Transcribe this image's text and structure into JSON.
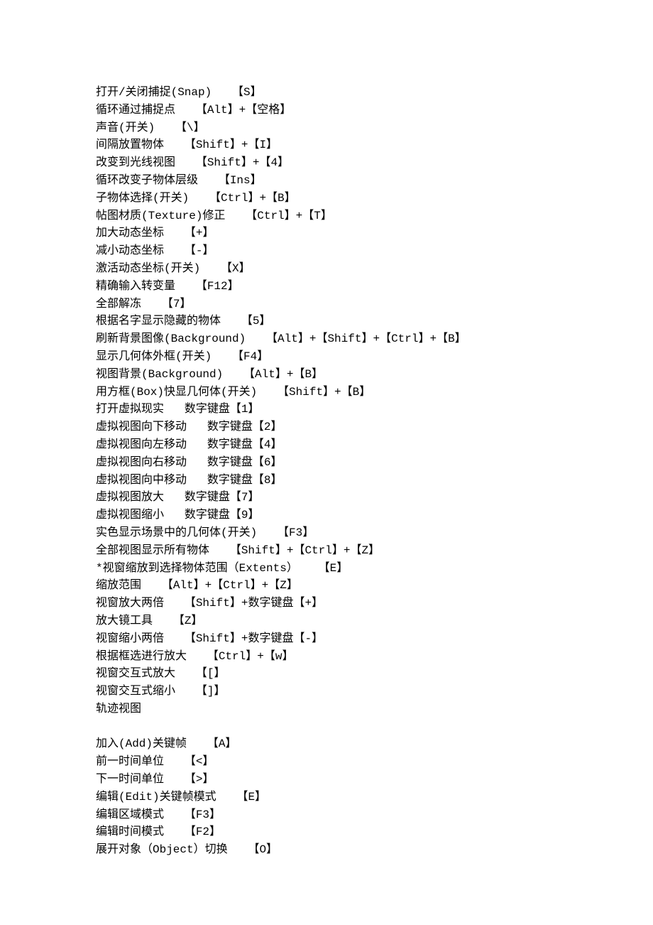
{
  "group1": [
    {
      "label": "打开/关闭捕捉(Snap)",
      "key": "【S】"
    },
    {
      "label": "循环通过捕捉点",
      "key": "【Alt】+【空格】"
    },
    {
      "label": "声音(开关)",
      "key": "【\\】"
    },
    {
      "label": "间隔放置物体",
      "key": "【Shift】+【I】"
    },
    {
      "label": "改变到光线视图",
      "key": "【Shift】+【4】"
    },
    {
      "label": "循环改变子物体层级",
      "key": "【Ins】"
    },
    {
      "label": "子物体选择(开关)",
      "key": "【Ctrl】+【B】"
    },
    {
      "label": "帖图材质(Texture)修正",
      "key": "【Ctrl】+【T】"
    },
    {
      "label": "加大动态坐标",
      "key": "【+】"
    },
    {
      "label": "减小动态坐标",
      "key": "【-】"
    },
    {
      "label": "激活动态坐标(开关)",
      "key": "【X】"
    },
    {
      "label": "精确输入转变量",
      "key": "【F12】"
    },
    {
      "label": "全部解冻",
      "key": "【7】"
    },
    {
      "label": "根据名字显示隐藏的物体",
      "key": "【5】"
    },
    {
      "label": "刷新背景图像(Background)",
      "key": "【Alt】+【Shift】+【Ctrl】+【B】"
    },
    {
      "label": "显示几何体外框(开关)",
      "key": "【F4】"
    },
    {
      "label": "视图背景(Background)",
      "key": "【Alt】+【B】"
    },
    {
      "label": "用方框(Box)快显几何体(开关)",
      "key": "【Shift】+【B】"
    },
    {
      "label": "打开虚拟现实",
      "key": "数字键盘【1】"
    },
    {
      "label": "虚拟视图向下移动",
      "key": "数字键盘【2】"
    },
    {
      "label": "虚拟视图向左移动",
      "key": "数字键盘【4】"
    },
    {
      "label": "虚拟视图向右移动",
      "key": "数字键盘【6】"
    },
    {
      "label": "虚拟视图向中移动",
      "key": "数字键盘【8】"
    },
    {
      "label": "虚拟视图放大",
      "key": "数字键盘【7】"
    },
    {
      "label": "虚拟视图缩小",
      "key": "数字键盘【9】"
    },
    {
      "label": "实色显示场景中的几何体(开关)",
      "key": "【F3】"
    },
    {
      "label": "全部视图显示所有物体",
      "key": "【Shift】+【Ctrl】+【Z】"
    },
    {
      "label": "*视窗缩放到选择物体范围（Extents）",
      "key": "【E】"
    },
    {
      "label": "缩放范围",
      "key": "【Alt】+【Ctrl】+【Z】"
    },
    {
      "label": "视窗放大两倍",
      "key": "【Shift】+数字键盘【+】"
    },
    {
      "label": "放大镜工具",
      "key": "【Z】"
    },
    {
      "label": "视窗缩小两倍",
      "key": "【Shift】+数字键盘【-】"
    },
    {
      "label": "根据框选进行放大",
      "key": "【Ctrl】+【w】"
    },
    {
      "label": "视窗交互式放大",
      "key": "【[】"
    },
    {
      "label": "视窗交互式缩小",
      "key": "【]】"
    }
  ],
  "section2_title": "轨迹视图",
  "group2": [
    {
      "label": "加入(Add)关键帧",
      "key": "【A】"
    },
    {
      "label": "前一时间单位",
      "key": "【<】"
    },
    {
      "label": "下一时间单位",
      "key": "【>】"
    },
    {
      "label": "编辑(Edit)关键帧模式",
      "key": "【E】"
    },
    {
      "label": "编辑区域模式",
      "key": "【F3】"
    },
    {
      "label": "编辑时间模式",
      "key": "【F2】"
    },
    {
      "label": "展开对象（Object）切换",
      "key": "【O】"
    }
  ]
}
